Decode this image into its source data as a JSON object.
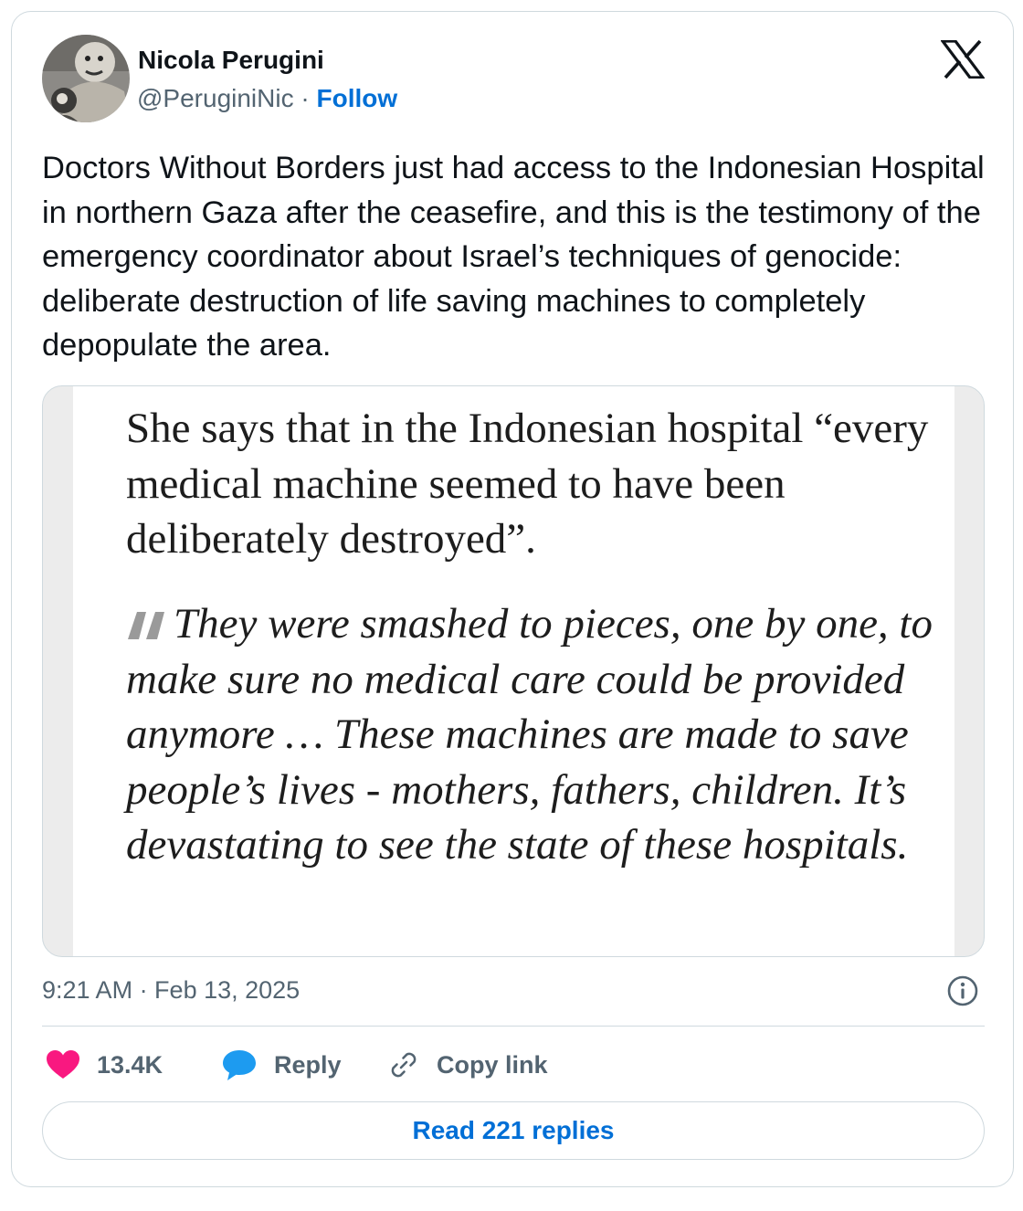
{
  "author": {
    "name": "Nicola Perugini",
    "handle": "@PeruginiNic",
    "separator": "·",
    "follow_label": "Follow"
  },
  "tweet": {
    "text": "Doctors Without Borders just had access to the Indonesian Hospital in northern Gaza after the ceasefire, and this is the testimony of the emergency coordinator about Israel’s techniques of genocide: deliberate destruction of life saving machines to completely depopulate the area.",
    "timestamp": "9:21 AM · Feb 13, 2025"
  },
  "media": {
    "lead_text": "She says that in the Indonesian hospital “every medical machine seemed to have been deliberately destroyed”.",
    "quote_text": "They were smashed to pieces, one by one, to make sure no medical care could be provided anymore … These machines are made to save people’s lives - mothers, fathers, children. It’s devastating to see the state of these hospitals."
  },
  "actions": {
    "like_count": "13.4K",
    "reply_label": "Reply",
    "copy_label": "Copy link"
  },
  "read_replies_label": "Read 221 replies",
  "colors": {
    "link_blue": "#006fd6",
    "like_pink": "#f91880",
    "reply_blue": "#1d9bf0",
    "muted": "#536471",
    "border": "#cfd9de"
  },
  "icons": [
    "x-logo-icon",
    "info-icon",
    "heart-icon",
    "reply-bubble-icon",
    "link-icon",
    "quote-mark-icon"
  ]
}
